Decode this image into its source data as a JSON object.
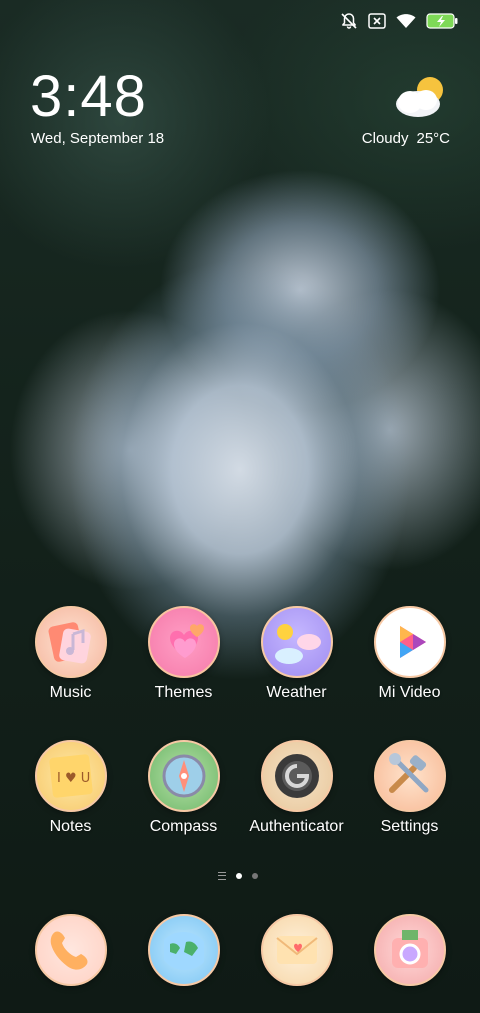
{
  "status_bar": {
    "icons": [
      "notifications-off-icon",
      "no-sim-icon",
      "wifi-icon",
      "battery-charging-icon"
    ]
  },
  "clock": {
    "time": "3:48",
    "date": "Wed, September 18"
  },
  "weather": {
    "icon": "partly-cloudy-icon",
    "condition": "Cloudy",
    "temperature": "25°C"
  },
  "apps_row1": [
    {
      "label": "Music",
      "icon": "music-icon"
    },
    {
      "label": "Themes",
      "icon": "themes-icon"
    },
    {
      "label": "Weather",
      "icon": "weather-icon"
    },
    {
      "label": "Mi Video",
      "icon": "mi-video-icon"
    }
  ],
  "apps_row2": [
    {
      "label": "Notes",
      "icon": "notes-icon"
    },
    {
      "label": "Compass",
      "icon": "compass-icon"
    },
    {
      "label": "Authenticator",
      "icon": "authenticator-icon"
    },
    {
      "label": "Settings",
      "icon": "settings-icon"
    }
  ],
  "page_indicator": {
    "pages": 2,
    "current": 1
  },
  "dock": [
    {
      "icon": "phone-icon"
    },
    {
      "icon": "browser-icon"
    },
    {
      "icon": "messaging-icon"
    },
    {
      "icon": "camera-icon"
    }
  ]
}
